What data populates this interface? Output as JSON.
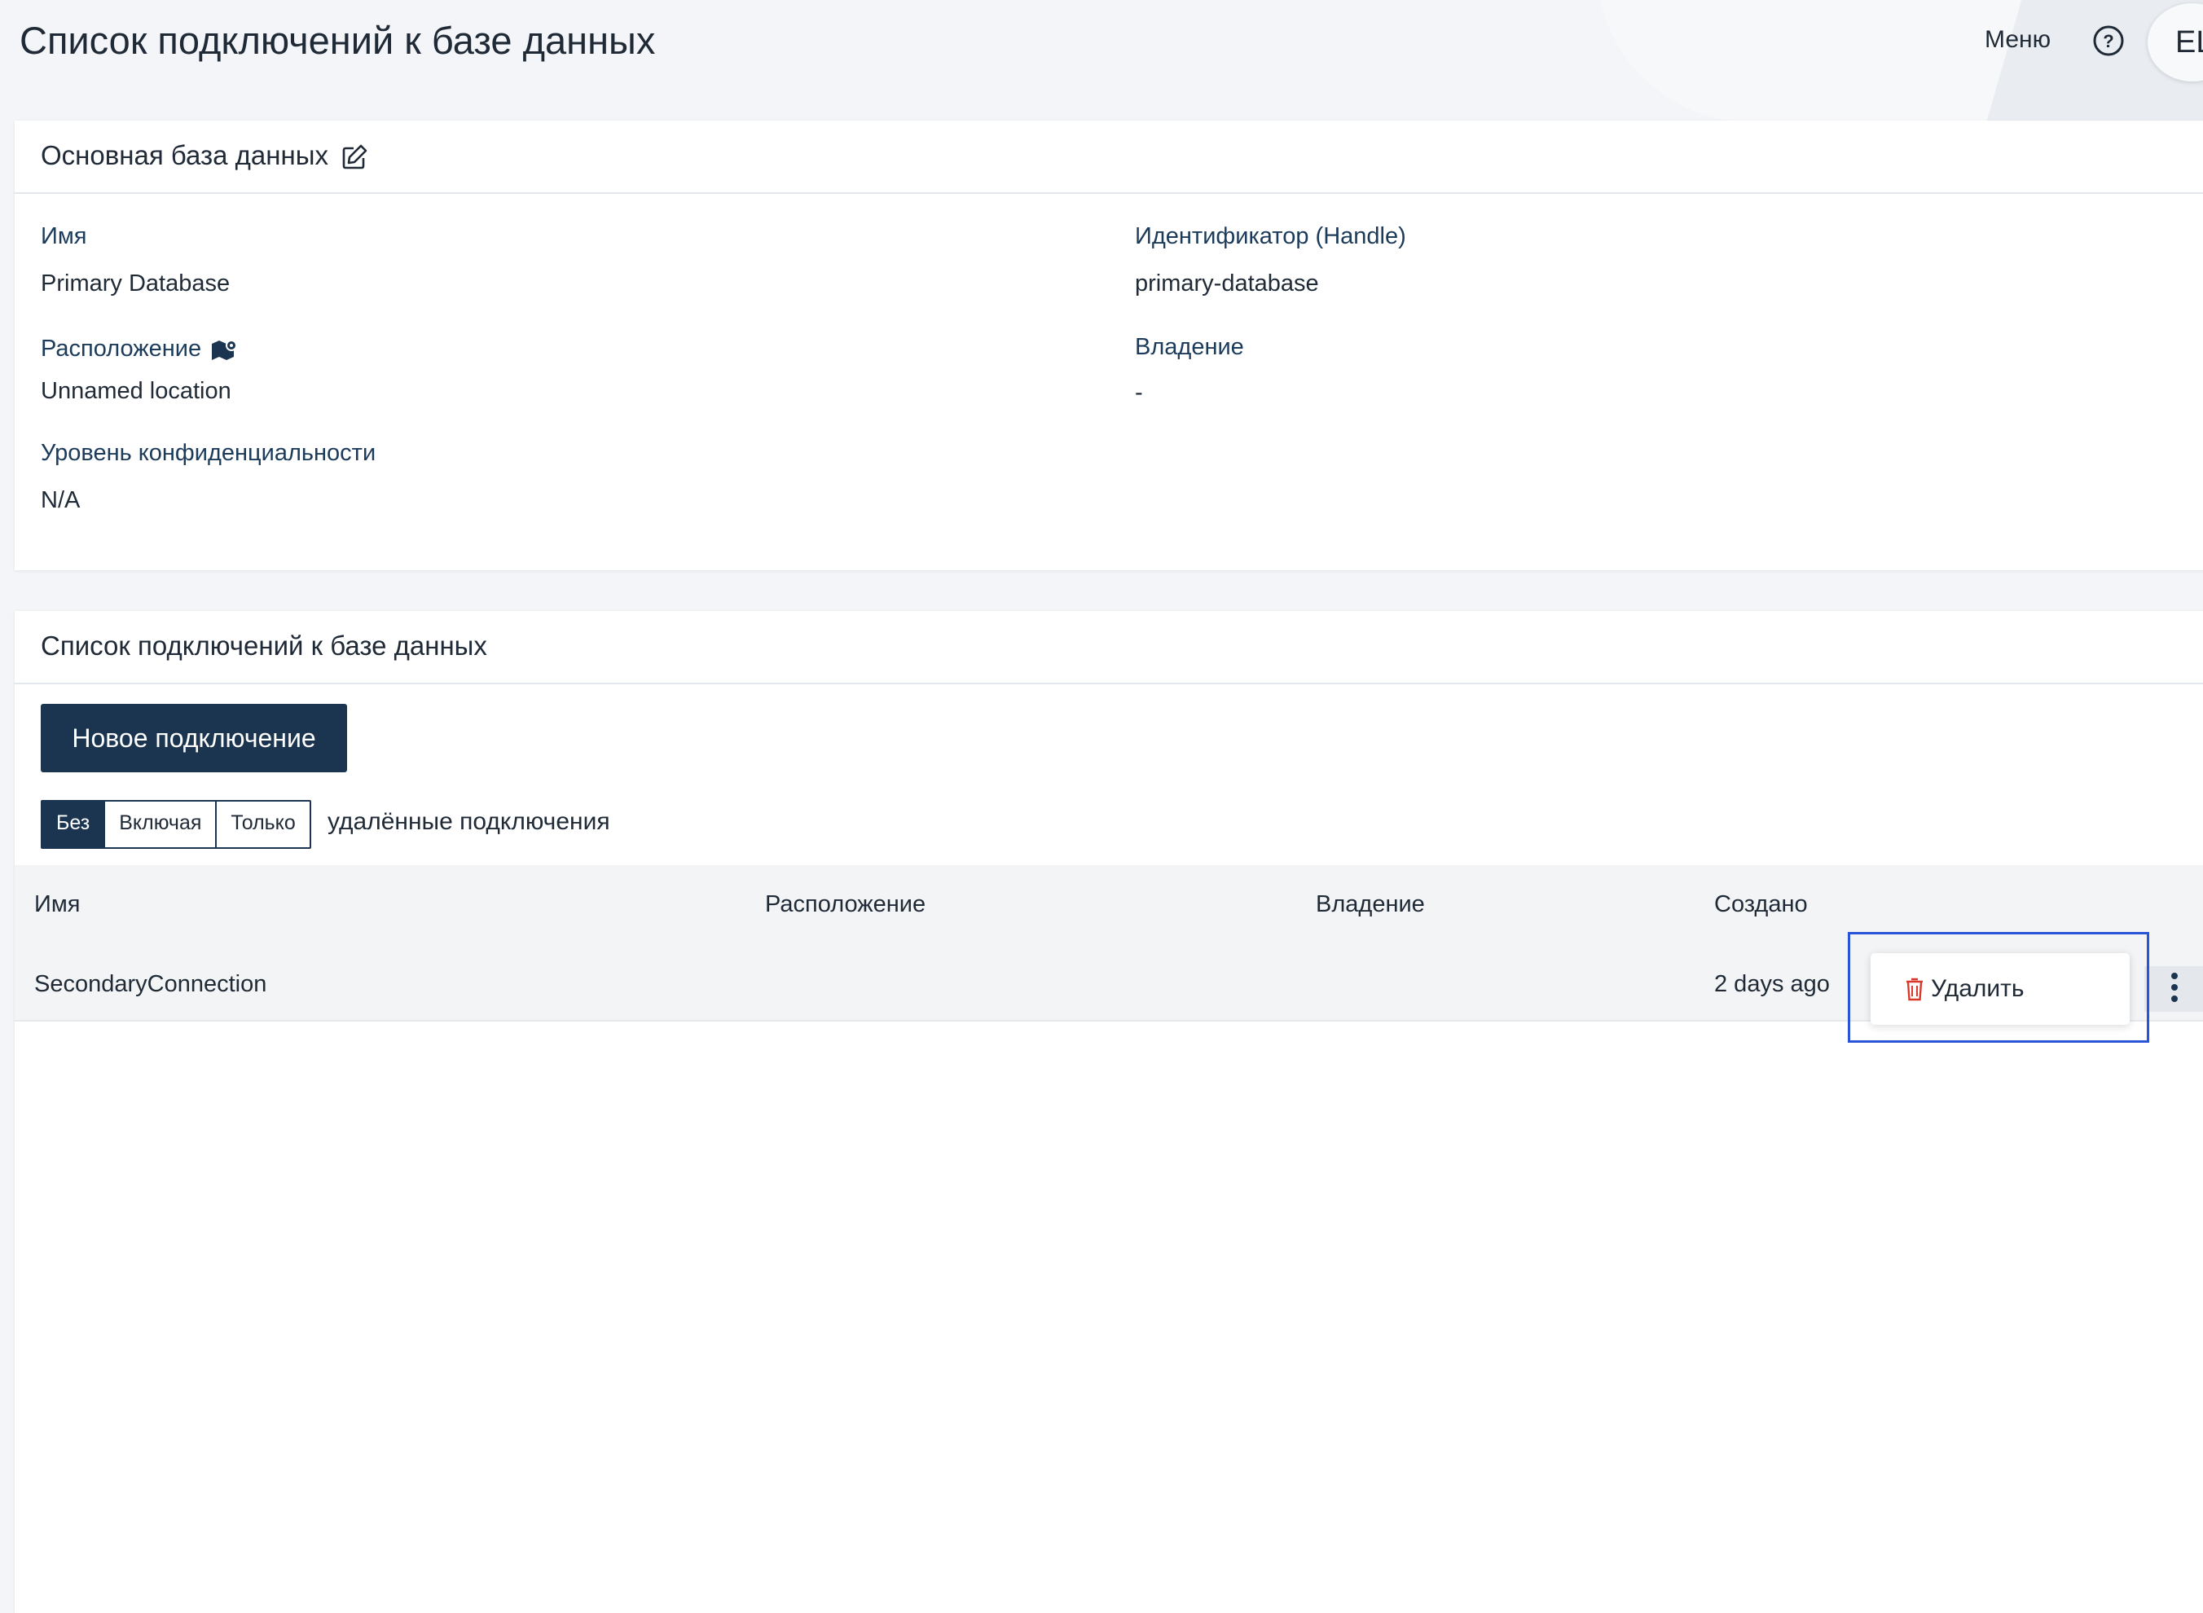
{
  "header": {
    "title": "Список подключений к базе данных",
    "menu_label": "Меню",
    "avatar_initials": "EL"
  },
  "primary_db": {
    "section_title": "Основная база данных",
    "name_label": "Имя",
    "name_value": "Primary Database",
    "handle_label": "Идентификатор (Handle)",
    "handle_value": "primary-database",
    "location_label": "Расположение",
    "location_value": "Unnamed location",
    "ownership_label": "Владение",
    "ownership_value": "-",
    "confidentiality_label": "Уровень конфиденциальности",
    "confidentiality_value": "N/A"
  },
  "connections": {
    "section_title": "Список подключений к базе данных",
    "new_button": "Новое подключение",
    "filter": {
      "options": [
        "Без",
        "Включая",
        "Только"
      ],
      "selected": "Без",
      "suffix": "удалённые подключения"
    },
    "columns": [
      "Имя",
      "Расположение",
      "Владение",
      "Создано"
    ],
    "rows": [
      {
        "name": "SecondaryConnection",
        "location": "",
        "ownership": "",
        "created": "2 days ago"
      }
    ],
    "row_menu": {
      "delete_label": "Удалить"
    }
  },
  "colors": {
    "accent": "#1b3550",
    "delete_icon": "#d9392b",
    "focus_frame": "#2a54d6"
  }
}
